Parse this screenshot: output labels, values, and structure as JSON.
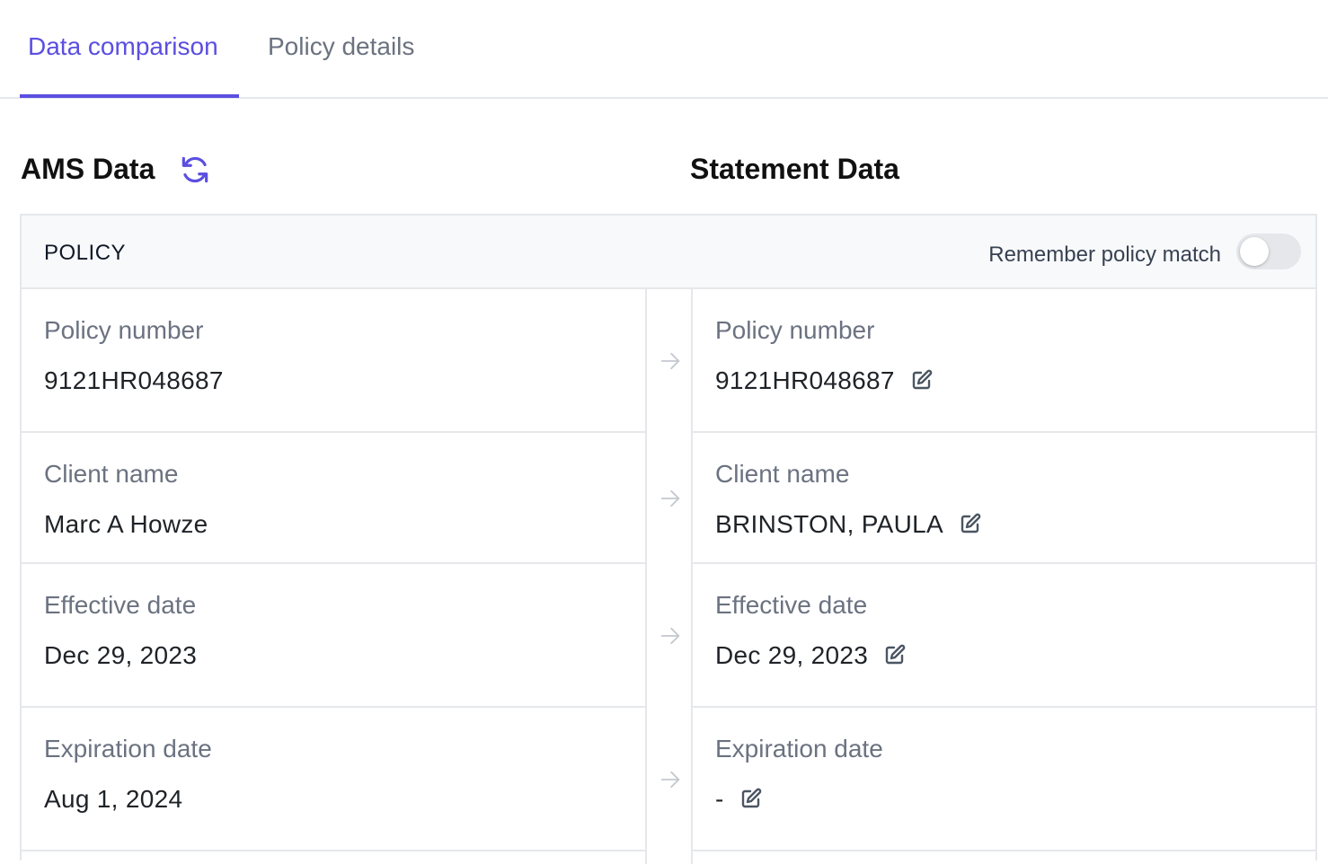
{
  "tabs": [
    {
      "label": "Data comparison",
      "active": true
    },
    {
      "label": "Policy details",
      "active": false
    }
  ],
  "ams": {
    "title": "AMS Data",
    "refresh_icon": "refresh-icon"
  },
  "statement": {
    "title": "Statement Data"
  },
  "card": {
    "header_label": "POLICY",
    "remember_label": "Remember policy match",
    "remember_enabled": false
  },
  "fields": [
    {
      "label": "Policy number",
      "ams_value": "9121HR048687",
      "statement_value": "9121HR048687"
    },
    {
      "label": "Client name",
      "ams_value": "Marc A Howze",
      "statement_value": "BRINSTON, PAULA"
    },
    {
      "label": "Effective date",
      "ams_value": "Dec 29, 2023",
      "statement_value": "Dec 29, 2023"
    },
    {
      "label": "Expiration date",
      "ams_value": "Aug 1, 2024",
      "statement_value": "-"
    }
  ],
  "colors": {
    "accent": "#5b4fe0",
    "border": "#e5e7eb",
    "muted_text": "#6b7280",
    "header_bg": "#f8f9fb"
  }
}
